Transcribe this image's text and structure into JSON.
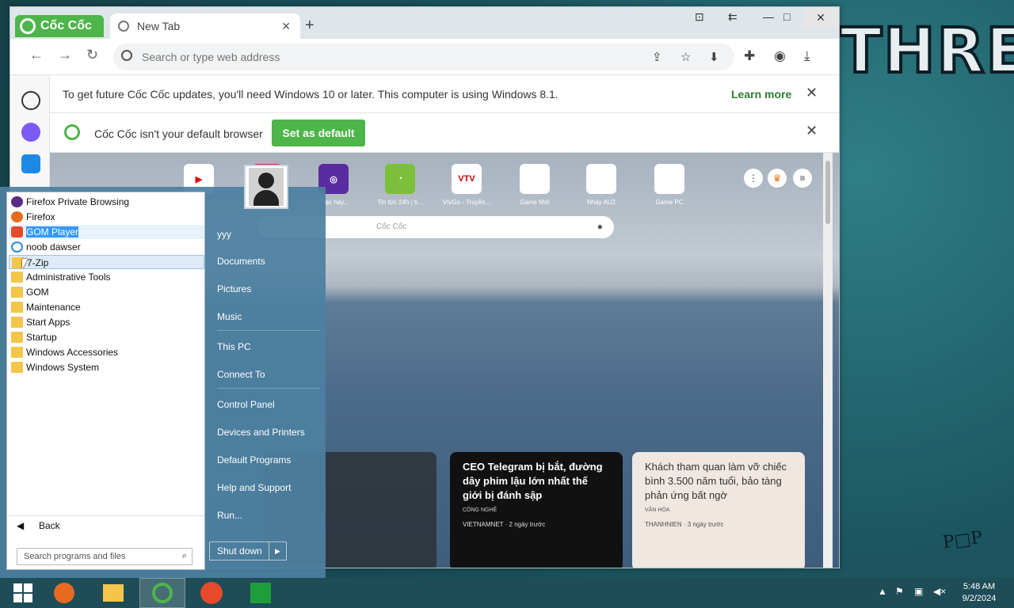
{
  "browser": {
    "brand": "Cốc Cốc",
    "tab_title": "New Tab",
    "omnibox_placeholder": "Search or type web address",
    "info_bar": {
      "message": "To get future Cốc Cốc updates, you'll need Windows 10 or later. This computer is using Windows 8.1.",
      "action": "Learn more"
    },
    "default_bar": {
      "message": "Cốc Cốc isn't your default browser",
      "button": "Set as default"
    },
    "speed_dial": [
      {
        "label": "",
        "icon": "youtube-icon"
      },
      {
        "label": "",
        "icon": "music-icon"
      },
      {
        "label": "nhạc hay...",
        "icon": "music-icon"
      },
      {
        "label": "Tin tức 24h | ti...",
        "icon": "news-icon"
      },
      {
        "label": "VtvGo - Truyền...",
        "icon": "vtv-icon"
      },
      {
        "label": "Game Mới",
        "icon": "page-icon"
      },
      {
        "label": "Nhảy AU2",
        "icon": "page-icon"
      },
      {
        "label": "Game PC",
        "icon": "page-icon"
      }
    ],
    "ntp_search_placeholder": "Cốc Cốc",
    "news": [
      {
        "title": "",
        "category": "",
        "source": ""
      },
      {
        "title": "CEO Telegram bị bắt, đường dây phim lậu lớn nhất thế giới bị đánh sập",
        "category": "CÔNG NGHỆ",
        "source": "VIETNAMNET · 2 ngày trước"
      },
      {
        "title": "Khách tham quan làm vỡ chiếc bình 3.500 năm tuổi, bảo tàng phản ứng bất ngờ",
        "category": "VĂN HÓA",
        "source": "THANHNIEN · 3 ngày trước"
      }
    ]
  },
  "start_menu": {
    "programs": [
      {
        "label": "Firefox Private Browsing",
        "icon": "firefox-private-icon"
      },
      {
        "label": "Firefox",
        "icon": "firefox-icon"
      },
      {
        "label": "GOM Player",
        "icon": "gom-player-icon"
      },
      {
        "label": "noob dawser",
        "icon": "ie-icon"
      },
      {
        "label": "7-Zip",
        "icon": "folder-icon"
      },
      {
        "label": "Administrative Tools",
        "icon": "folder-icon"
      },
      {
        "label": "GOM",
        "icon": "folder-icon"
      },
      {
        "label": "Maintenance",
        "icon": "folder-icon"
      },
      {
        "label": "Start Apps",
        "icon": "folder-icon"
      },
      {
        "label": "Startup",
        "icon": "folder-icon"
      },
      {
        "label": "Windows Accessories",
        "icon": "folder-icon"
      },
      {
        "label": "Windows System",
        "icon": "folder-icon"
      }
    ],
    "back_label": "Back",
    "search_placeholder": "Search programs and files",
    "places": [
      "yyy",
      "Documents",
      "Pictures",
      "Music",
      "This PC",
      "Connect To",
      "Control Panel",
      "Devices and Printers",
      "Default Programs",
      "Help and Support",
      "Run..."
    ],
    "shutdown_label": "Shut down"
  },
  "taskbar": {
    "time": "5:48 AM",
    "date": "9/2/2024"
  },
  "wallpaper_text": "THREAT"
}
